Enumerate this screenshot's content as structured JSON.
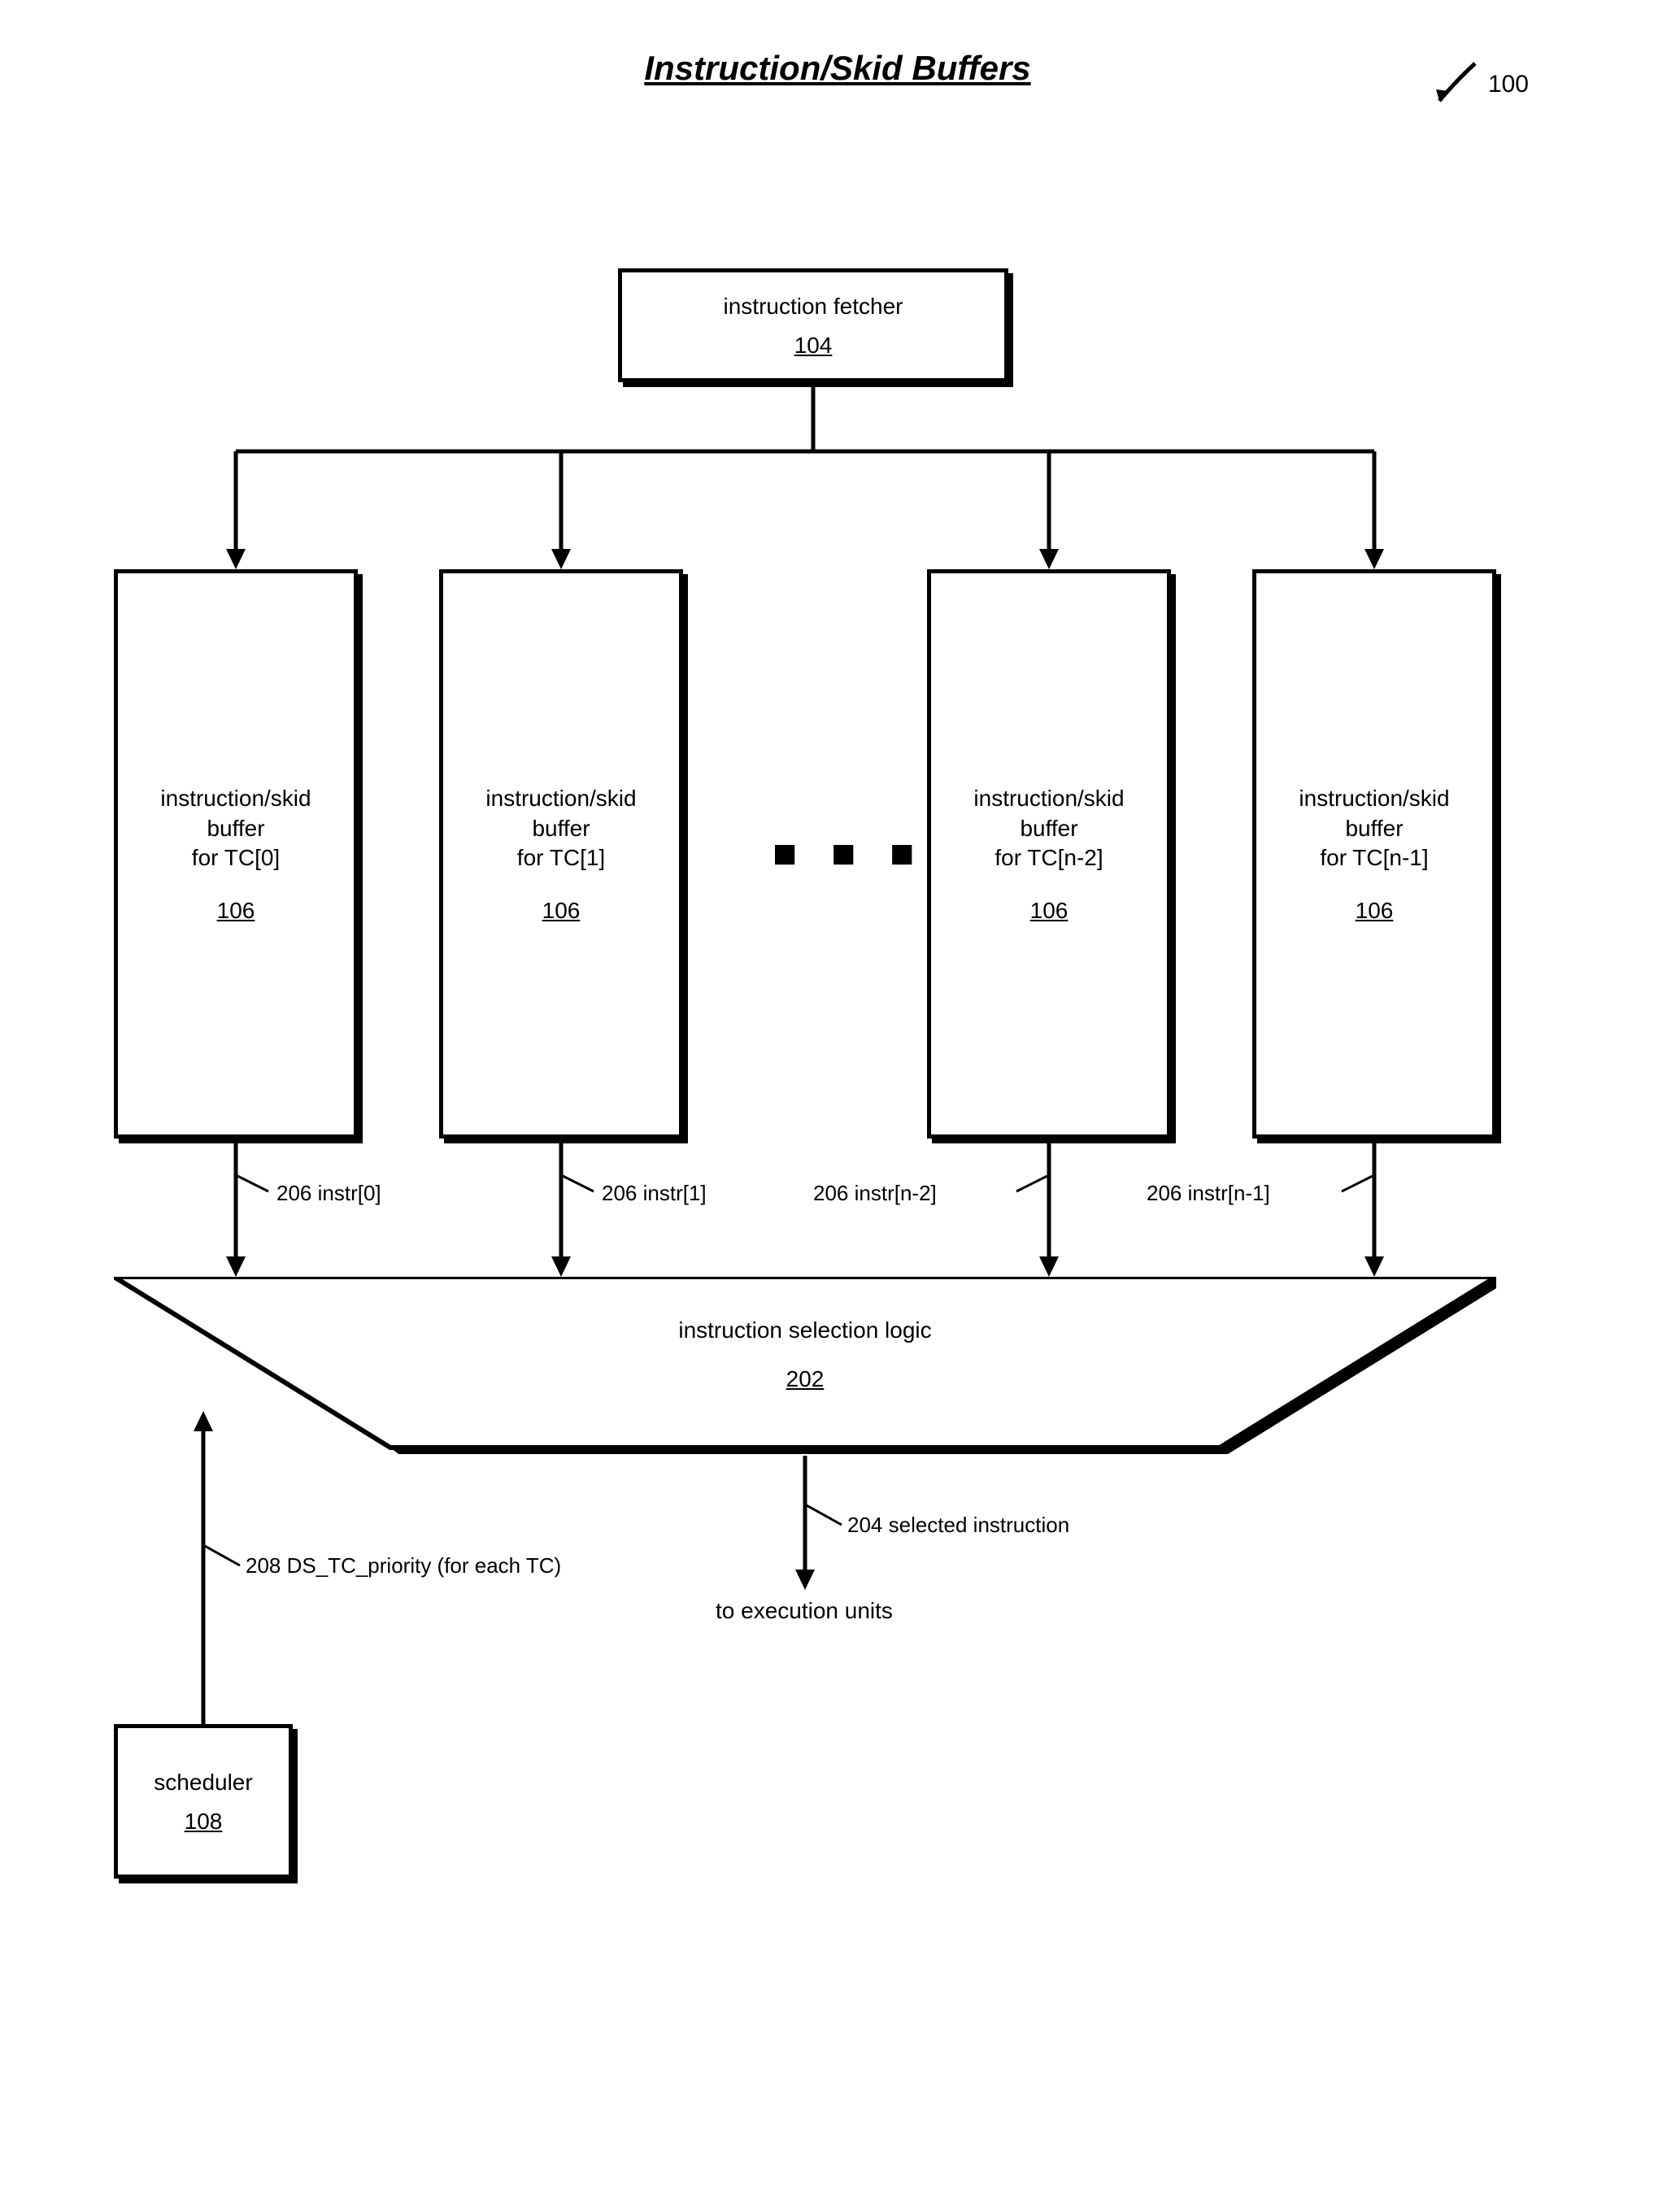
{
  "title": "Instruction/Skid Buffers",
  "ref_num": "100",
  "fetcher": {
    "label": "instruction fetcher",
    "num": "104"
  },
  "buffers": [
    {
      "line1": "instruction/skid",
      "line2": "buffer",
      "line3": "for TC[0]",
      "num": "106"
    },
    {
      "line1": "instruction/skid",
      "line2": "buffer",
      "line3": "for TC[1]",
      "num": "106"
    },
    {
      "line1": "instruction/skid",
      "line2": "buffer",
      "line3": "for TC[n-2]",
      "num": "106"
    },
    {
      "line1": "instruction/skid",
      "line2": "buffer",
      "line3": "for TC[n-1]",
      "num": "106"
    }
  ],
  "dots": "■ ■ ■",
  "instr_labels": [
    "206  instr[0]",
    "206  instr[1]",
    "206  instr[n-2]",
    "206  instr[n-1]"
  ],
  "mux": {
    "label": "instruction selection logic",
    "num": "202"
  },
  "priority_label": "208 DS_TC_priority (for each TC)",
  "selected_label": "204 selected instruction",
  "to_exec": "to execution units",
  "scheduler": {
    "label": "scheduler",
    "num": "108"
  }
}
